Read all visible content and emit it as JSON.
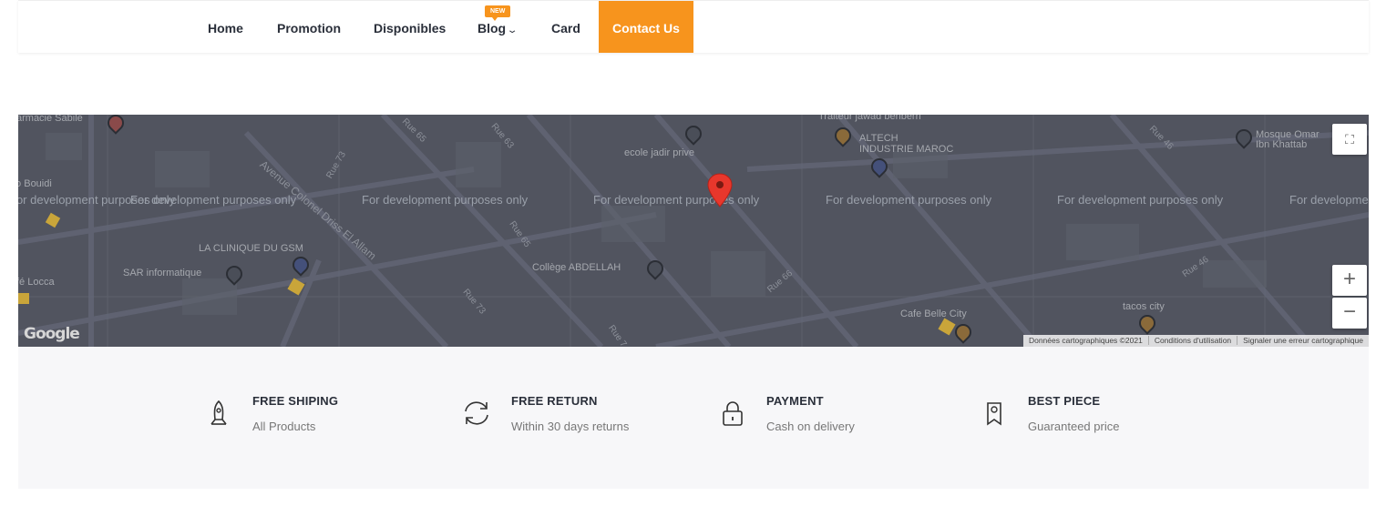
{
  "nav": {
    "items": [
      {
        "label": "Home"
      },
      {
        "label": "Promotion"
      },
      {
        "label": "Disponibles"
      },
      {
        "label": "Blog",
        "badge": "NEW"
      },
      {
        "label": "Card"
      },
      {
        "label": "Contact Us"
      }
    ],
    "accent": "#f7941d"
  },
  "map": {
    "dev_watermark": "For development purposes only",
    "pois": [
      "armacie Sabile",
      "ecole jadir prive",
      "Traiteur jawad benberri",
      "ALTECH",
      "INDUSTRIE MAROC",
      "Mosque Omar",
      "Ibn Khattab",
      "to Bouidi",
      "LA CLINIQUE DU GSM",
      "SAR informatique",
      "fé Locca",
      "Collège ABDELLAH",
      "Cafe Belle City",
      "tacos city"
    ],
    "streets": [
      "Rue 65",
      "Rue 63",
      "Rue 73",
      "Avenue Colonel Driss El Allam",
      "Rue 65",
      "Rue 73",
      "Rue 66",
      "Rue 46",
      "Rue 46",
      "Rue 7"
    ],
    "logo": "Google",
    "footer": [
      "Données cartographiques ©2021",
      "Conditions d'utilisation",
      "Signaler une erreur cartographique"
    ],
    "zoom_in": "+",
    "zoom_out": "−"
  },
  "features": [
    {
      "icon": "rocket-icon",
      "title": "FREE SHIPING",
      "subtitle": "All Products"
    },
    {
      "icon": "refresh-icon",
      "title": "FREE RETURN",
      "subtitle": "Within 30 days returns"
    },
    {
      "icon": "lock-icon",
      "title": "PAYMENT",
      "subtitle": "Cash on delivery"
    },
    {
      "icon": "badge-icon",
      "title": "BEST PIECE",
      "subtitle": "Guaranteed price"
    }
  ]
}
